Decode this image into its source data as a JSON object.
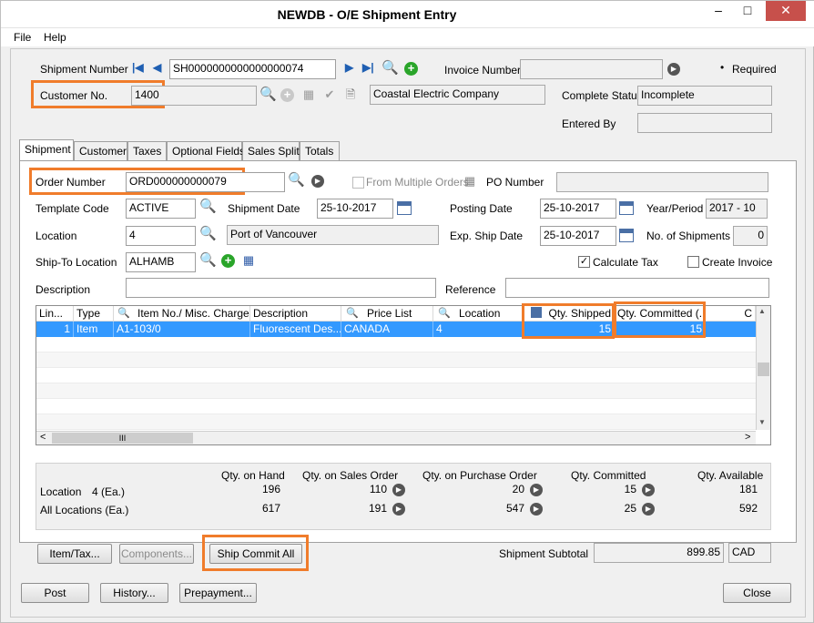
{
  "window": {
    "title": "NEWDB - O/E Shipment Entry",
    "min": "–",
    "max": "□",
    "close": "✕"
  },
  "menu": {
    "file": "File",
    "help": "Help"
  },
  "header": {
    "shipment_number_label": "Shipment Number",
    "shipment_number": "SH0000000000000000074",
    "invoice_number_label": "Invoice Number",
    "invoice_number": "",
    "required_marker": "•",
    "required_label": "Required",
    "customer_no_label": "Customer No.",
    "customer_no": "1400",
    "customer_name": "Coastal Electric Company",
    "complete_status_label": "Complete Status",
    "complete_status": "Incomplete",
    "entered_by_label": "Entered By",
    "entered_by": ""
  },
  "tabs": [
    {
      "label": "Shipment"
    },
    {
      "label": "Customer"
    },
    {
      "label": "Taxes"
    },
    {
      "label": "Optional Fields"
    },
    {
      "label": "Sales Split"
    },
    {
      "label": "Totals"
    }
  ],
  "shipment": {
    "order_number_label": "Order Number",
    "order_number": "ORD000000000079",
    "from_multiple_orders_label": "From Multiple Orders",
    "po_number_label": "PO Number",
    "po_number": "",
    "template_code_label": "Template Code",
    "template_code": "ACTIVE",
    "shipment_date_label": "Shipment Date",
    "shipment_date": "25-10-2017",
    "posting_date_label": "Posting Date",
    "posting_date": "25-10-2017",
    "year_period_label": "Year/Period",
    "year_period": "2017 - 10",
    "location_label": "Location",
    "location": "4",
    "location_name": "Port of Vancouver",
    "exp_ship_date_label": "Exp. Ship Date",
    "exp_ship_date": "25-10-2017",
    "no_of_shipments_label": "No. of Shipments",
    "no_of_shipments": "0",
    "ship_to_location_label": "Ship-To Location",
    "ship_to_location": "ALHAMB",
    "calculate_tax_label": "Calculate Tax",
    "calculate_tax_check": "✓",
    "create_invoice_label": "Create Invoice",
    "description_label": "Description",
    "description": "",
    "reference_label": "Reference",
    "reference": ""
  },
  "grid": {
    "headers": [
      "Lin...",
      "Type",
      "Item No./ Misc. Charge",
      "Description",
      "Price List",
      "Location",
      "Qty. Shipped",
      "Qty. Committed (...",
      "C"
    ],
    "rows": [
      {
        "line": "1",
        "type": "Item",
        "item": "A1-103/0",
        "description": "Fluorescent Des...",
        "price_list": "CANADA",
        "location": "4",
        "qty_shipped": "15",
        "qty_committed": "15"
      }
    ],
    "hscroll_thumb": "III",
    "left_arrow": "<",
    "right_arrow": ">",
    "up_arrow": "▲",
    "down_arrow": "▼"
  },
  "summary": {
    "headers": [
      "Qty. on Hand",
      "Qty. on Sales Order",
      "Qty. on Purchase Order",
      "Qty. Committed",
      "Qty. Available"
    ],
    "location_label": "Location",
    "location_unit": "4 (Ea.)",
    "location_values": [
      "196",
      "110",
      "20",
      "15",
      "181"
    ],
    "all_label": "All Locations (Ea.)",
    "all_values": [
      "617",
      "191",
      "547",
      "25",
      "592"
    ]
  },
  "footer": {
    "item_tax": "Item/Tax...",
    "components": "Components...",
    "ship_commit_all": "Ship Commit All",
    "shipment_subtotal_label": "Shipment Subtotal",
    "shipment_subtotal": "899.85",
    "currency": "CAD"
  },
  "bottom_buttons": {
    "post": "Post",
    "history": "History...",
    "prepayment": "Prepayment...",
    "close": "Close"
  },
  "colors": {
    "highlight": "#f07c2b",
    "selection": "#3399ff",
    "add_green": "#2aa52a"
  }
}
